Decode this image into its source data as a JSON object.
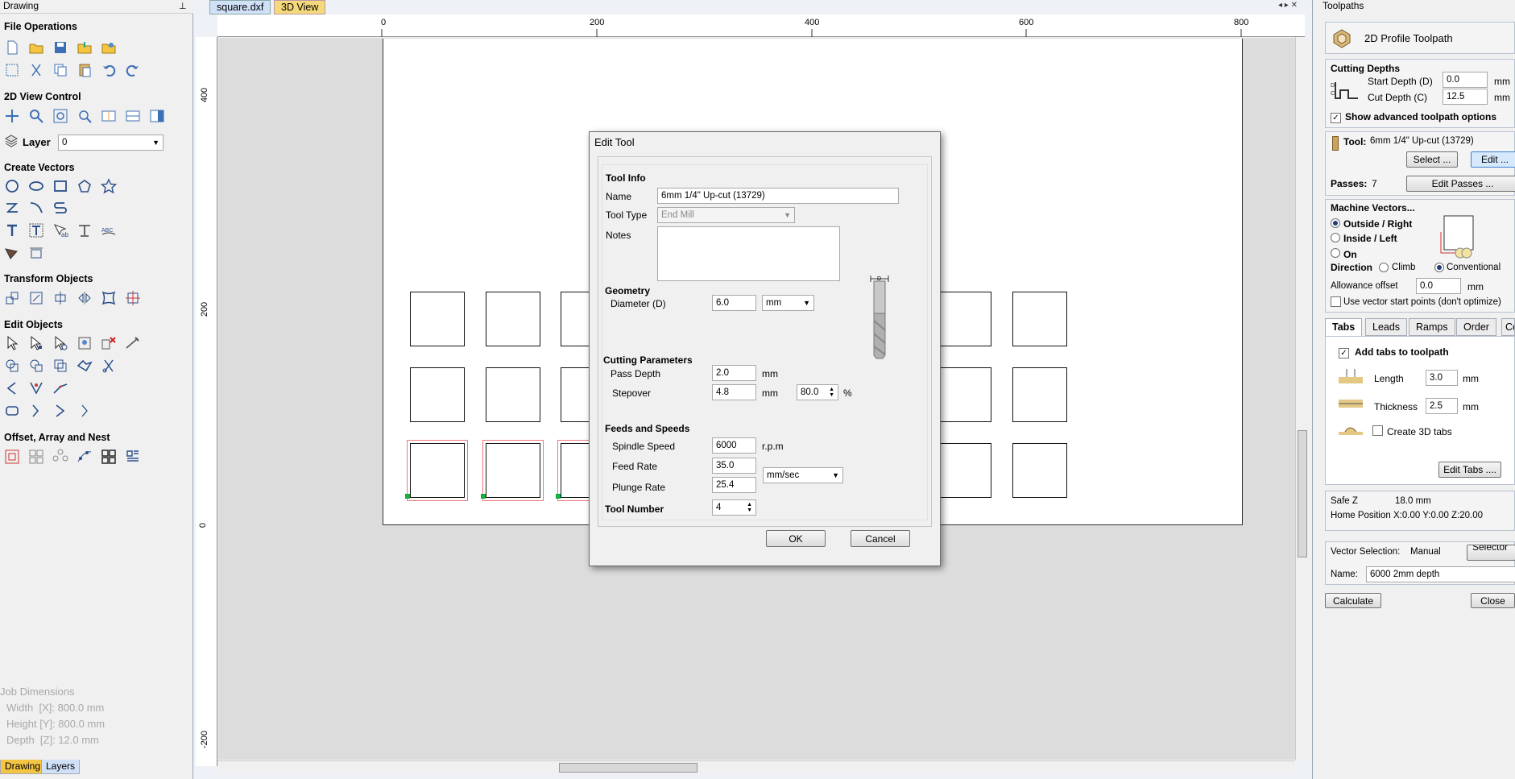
{
  "left_panel": {
    "title": "Drawing",
    "sections": {
      "file": "File Operations",
      "view": "2D View Control",
      "create": "Create Vectors",
      "transform": "Transform Objects",
      "edit": "Edit Objects",
      "offset": "Offset, Array and Nest"
    },
    "layer_label": "Layer",
    "layer_value": "0",
    "job_dimensions": {
      "title": "Job Dimensions",
      "width": "Width  [X]: 800.0 mm",
      "height": "Height [Y]: 800.0 mm",
      "depth": "Depth  [Z]: 12.0 mm"
    },
    "tabs": [
      "Drawing",
      "Layers"
    ]
  },
  "center": {
    "tabs": [
      "square.dxf",
      "3D View"
    ],
    "ruler_top": [
      "0",
      "200",
      "400",
      "600",
      "800"
    ],
    "ruler_left": [
      "400",
      "200",
      "0",
      "-200"
    ]
  },
  "dialog": {
    "title": "Edit Tool",
    "tool_info": "Tool Info",
    "name_label": "Name",
    "name_value": "6mm 1/4\" Up-cut (13729)",
    "tool_type_label": "Tool Type",
    "tool_type_value": "End Mill",
    "notes_label": "Notes",
    "geometry": "Geometry",
    "diameter_label": "Diameter (D)",
    "diameter_value": "6.0",
    "diameter_unit": "mm",
    "cutting_params": "Cutting Parameters",
    "pass_depth_label": "Pass Depth",
    "pass_depth_value": "2.0",
    "pass_depth_unit": "mm",
    "stepover_label": "Stepover",
    "stepover_value": "4.8",
    "stepover_unit": "mm",
    "stepover_pct": "80.0",
    "pct_sign": "%",
    "feeds": "Feeds and Speeds",
    "spindle_label": "Spindle Speed",
    "spindle_value": "6000",
    "spindle_unit": "r.p.m",
    "feed_label": "Feed Rate",
    "feed_value": "35.0",
    "plunge_label": "Plunge Rate",
    "plunge_value": "25.4",
    "rate_unit": "mm/sec",
    "tool_number_label": "Tool Number",
    "tool_number_value": "4",
    "ok": "OK",
    "cancel": "Cancel",
    "diagram_label": "D"
  },
  "right_panel": {
    "title": "Toolpaths",
    "header": "2D Profile Toolpath",
    "cutting_depths": "Cutting Depths",
    "start_depth_label": "Start Depth (D)",
    "start_depth_value": "0.0",
    "cut_depth_label": "Cut Depth (C)",
    "cut_depth_value": "12.5",
    "unit": "mm",
    "show_advanced": "Show advanced toolpath options",
    "tool_label": "Tool:",
    "tool_value": "6mm 1/4\" Up-cut (13729)",
    "select_btn": "Select ...",
    "edit_btn": "Edit ...",
    "passes_label": "Passes:",
    "passes_value": "7",
    "edit_passes_btn": "Edit Passes ...",
    "machine_vectors": "Machine Vectors...",
    "outside": "Outside / Right",
    "inside": "Inside / Left",
    "on": "On",
    "direction": "Direction",
    "climb": "Climb",
    "conventional": "Conventional",
    "allowance_label": "Allowance offset",
    "allowance_value": "0.0",
    "vector_start": "Use vector start points (don't optimize)",
    "tabs": [
      "Tabs",
      "Leads",
      "Ramps",
      "Order",
      "Corners"
    ],
    "add_tabs": "Add tabs to toolpath",
    "length_label": "Length",
    "length_value": "3.0",
    "thickness_label": "Thickness",
    "thickness_value": "2.5",
    "create_3d": "Create 3D tabs",
    "edit_tabs_btn": "Edit Tabs ....",
    "safe_z_label": "Safe Z",
    "safe_z_value": "18.0 mm",
    "home_label": "Home Position",
    "home_value": "X:0.00 Y:0.00 Z:20.00",
    "vector_sel_label": "Vector Selection:",
    "vector_sel_value": "Manual",
    "selector_btn": "Selector ...",
    "name_label": "Name:",
    "name_value": "6000 2mm depth",
    "calculate_btn": "Calculate",
    "close_btn": "Close"
  }
}
